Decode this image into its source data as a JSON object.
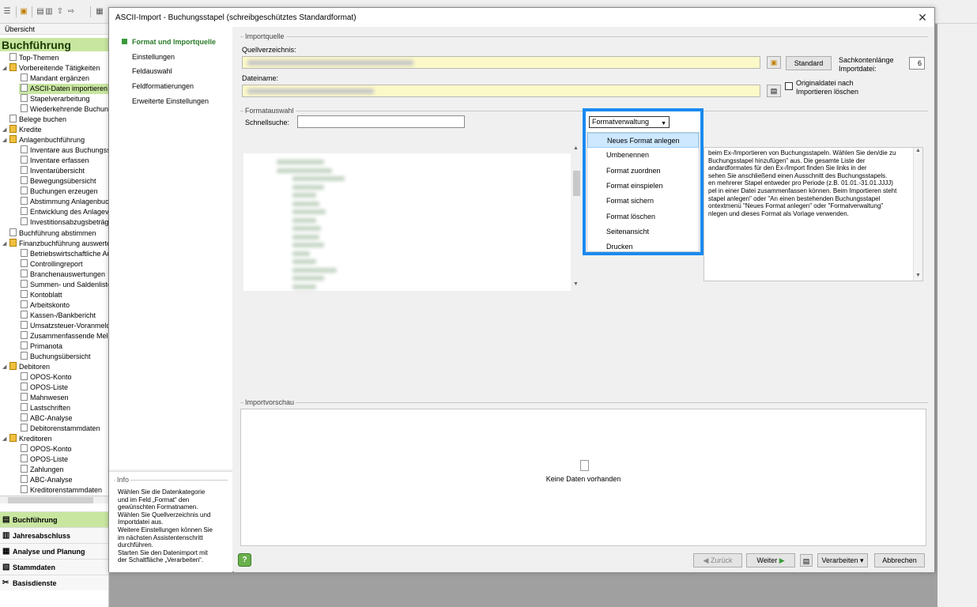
{
  "background": {
    "nav_tab": "Übersicht",
    "nav_title": "Buchführung",
    "tree": [
      {
        "label": "Top-Themen",
        "level": 1,
        "type": "doc"
      },
      {
        "label": "Vorbereitende Tätigkeiten",
        "level": 1,
        "type": "folder"
      },
      {
        "label": "Mandant ergänzen",
        "level": 2,
        "type": "doc"
      },
      {
        "label": "ASCII-Daten importieren",
        "level": 2,
        "type": "doc",
        "selected": true
      },
      {
        "label": "Stapelverarbeitung",
        "level": 2,
        "type": "doc"
      },
      {
        "label": "Wiederkehrende Buchun",
        "level": 2,
        "type": "doc"
      },
      {
        "label": "Belege buchen",
        "level": 1,
        "type": "doc"
      },
      {
        "label": "Kredite",
        "level": 1,
        "type": "folder"
      },
      {
        "label": "Anlagenbuchführung",
        "level": 1,
        "type": "folder"
      },
      {
        "label": "Inventare aus Buchungss",
        "level": 2,
        "type": "doc"
      },
      {
        "label": "Inventare erfassen",
        "level": 2,
        "type": "doc"
      },
      {
        "label": "Inventarübersicht",
        "level": 2,
        "type": "doc"
      },
      {
        "label": "Bewegungsübersicht",
        "level": 2,
        "type": "doc"
      },
      {
        "label": "Buchungen erzeugen",
        "level": 2,
        "type": "doc"
      },
      {
        "label": "Abstimmung Anlagenbuch",
        "level": 2,
        "type": "doc"
      },
      {
        "label": "Entwicklung des Anlagev",
        "level": 2,
        "type": "doc"
      },
      {
        "label": "Investitionsabzugsbeträge",
        "level": 2,
        "type": "doc"
      },
      {
        "label": "Buchführung abstimmen",
        "level": 1,
        "type": "doc"
      },
      {
        "label": "Finanzbuchführung auswerte",
        "level": 1,
        "type": "folder"
      },
      {
        "label": "Betriebswirtschaftliche Au",
        "level": 2,
        "type": "doc"
      },
      {
        "label": "Controllingreport",
        "level": 2,
        "type": "doc"
      },
      {
        "label": "Branchenauswertungen",
        "level": 2,
        "type": "doc"
      },
      {
        "label": "Summen- und Saldenliste",
        "level": 2,
        "type": "doc"
      },
      {
        "label": "Kontoblatt",
        "level": 2,
        "type": "doc"
      },
      {
        "label": "Arbeitskonto",
        "level": 2,
        "type": "doc"
      },
      {
        "label": "Kassen-/Bankbericht",
        "level": 2,
        "type": "doc"
      },
      {
        "label": "Umsatzsteuer-Voranmeldu",
        "level": 2,
        "type": "doc"
      },
      {
        "label": "Zusammenfassende Meld",
        "level": 2,
        "type": "doc"
      },
      {
        "label": "Primanota",
        "level": 2,
        "type": "doc"
      },
      {
        "label": "Buchungsübersicht",
        "level": 2,
        "type": "doc"
      },
      {
        "label": "Debitoren",
        "level": 1,
        "type": "folder"
      },
      {
        "label": "OPOS-Konto",
        "level": 2,
        "type": "doc"
      },
      {
        "label": "OPOS-Liste",
        "level": 2,
        "type": "doc"
      },
      {
        "label": "Mahnwesen",
        "level": 2,
        "type": "doc"
      },
      {
        "label": "Lastschriften",
        "level": 2,
        "type": "doc"
      },
      {
        "label": "ABC-Analyse",
        "level": 2,
        "type": "doc"
      },
      {
        "label": "Debitorenstammdaten",
        "level": 2,
        "type": "doc"
      },
      {
        "label": "Kreditoren",
        "level": 1,
        "type": "folder"
      },
      {
        "label": "OPOS-Konto",
        "level": 2,
        "type": "doc"
      },
      {
        "label": "OPOS-Liste",
        "level": 2,
        "type": "doc"
      },
      {
        "label": "Zahlungen",
        "level": 2,
        "type": "doc"
      },
      {
        "label": "ABC-Analyse",
        "level": 2,
        "type": "doc"
      },
      {
        "label": "Kreditorenstammdaten",
        "level": 2,
        "type": "doc"
      }
    ],
    "modules": [
      {
        "label": "Buchführung",
        "active": true
      },
      {
        "label": "Jahresabschluss",
        "active": false
      },
      {
        "label": "Analyse und Planung",
        "active": false
      },
      {
        "label": "Stammdaten",
        "active": false
      },
      {
        "label": "Basisdienste",
        "active": false
      }
    ]
  },
  "dialog": {
    "title": "ASCII-Import - Buchungsstapel (schreibgeschütztes Standardformat)",
    "close_glyph": "✕",
    "steps": [
      {
        "label": "Format und Importquelle",
        "active": true
      },
      {
        "label": "Einstellungen",
        "active": false
      },
      {
        "label": "Feldauswahl",
        "active": false
      },
      {
        "label": "Feldformatierungen",
        "active": false
      },
      {
        "label": "Erweiterte Einstellungen",
        "active": false
      }
    ],
    "info": {
      "legend": "Info",
      "text": "Wählen Sie die Datenkategorie\nund im Feld „Format“ den\ngewünschten Formatnamen.\nWählen Sie Quellverzeichnis und\nImportdatei aus.\nWeitere Einstellungen können Sie\nim nächsten Assistentenschritt\ndurchführen.\nStarten Sie den Datenimport mit\nder Schaltfläche „Verarbeiten“."
    },
    "importquelle": {
      "legend": "Importquelle",
      "quellverzeichnis_label": "Quellverzeichnis:",
      "dateiname_label": "Dateiname:",
      "standard_button": "Standard",
      "sachkontenlaenge_label": "Sachkontenlänge\nImportdatei:",
      "sachkontenlaenge_value": "6",
      "originaldatei_label": "Originaldatei nach\nImportieren löschen",
      "originaldatei_checked": false
    },
    "formatauswahl": {
      "legend": "Formatauswahl",
      "schnellsuche_label": "Schnellsuche:",
      "schnellsuche_value": "",
      "formatverwaltung_button": "Formatverwaltung",
      "menu_items": [
        {
          "label": "Neues Format anlegen",
          "highlighted": true
        },
        {
          "label": "Umbenennen",
          "highlighted": false
        },
        {
          "label": "Format zuordnen",
          "highlighted": false
        },
        {
          "label": "Format einspielen",
          "highlighted": false
        },
        {
          "label": "Format sichern",
          "highlighted": false
        },
        {
          "label": "Format löschen",
          "highlighted": false
        },
        {
          "label": "Seitenansicht",
          "highlighted": false
        },
        {
          "label": "Drucken",
          "highlighted": false
        }
      ],
      "description": "beim Ex-/Importieren von Buchungsstapeln. Wählen Sie den/die zu\nBuchungsstapel hinzufügen\" aus. Die gesamte Liste der\nandardformates für den Ex-/Import finden Sie links in der\nsehen Sie anschließend einen Ausschnitt des Buchungsstapels.\nen mehrerer Stapel entweder pro Periode (z.B. 01.01.-31.01.JJJJ)\npel in einer Datei zusammenfassen können. Beim Importieren steht\nstapel anlegen\" oder \"An einen bestehenden Buchungsstapel\nontextmenü \"Neues Format anlegen\" oder \"Formatverwaltung\"\nnlegen und dieses Format als Vorlage verwenden."
    },
    "importvorschau": {
      "legend": "Importvorschau",
      "empty_text": "Keine Daten vorhanden"
    },
    "footer": {
      "help": "?",
      "back": "Zurück",
      "next": "Weiter",
      "process": "Verarbeiten",
      "cancel": "Abbrechen"
    }
  },
  "colors": {
    "accent_green": "#c8e6a0",
    "dropdown_highlight": "#1a8af0",
    "input_yellow": "#fcf9c8"
  }
}
